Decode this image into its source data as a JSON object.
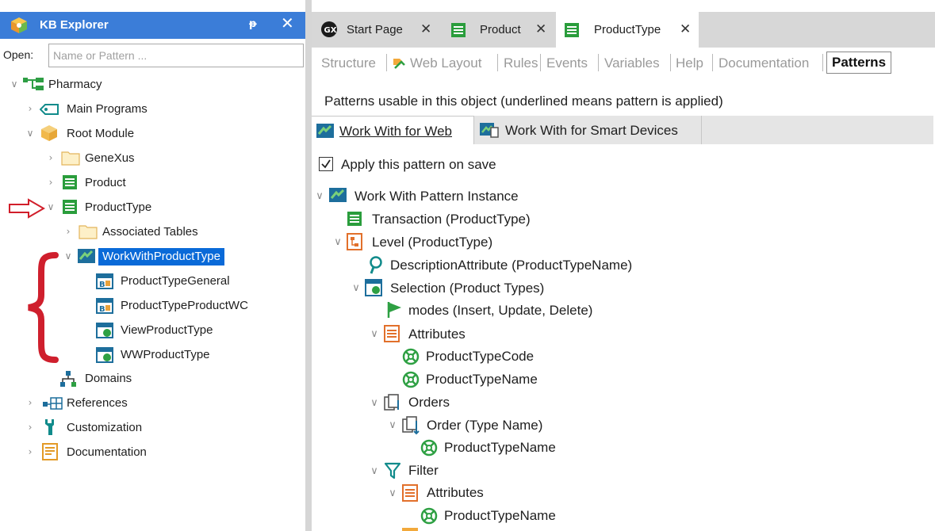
{
  "kb_explorer": {
    "title": "KB Explorer",
    "pin_glyph": "ᵽ",
    "close_glyph": "✕",
    "open_label": "Open:",
    "open_placeholder": "Name or Pattern ...",
    "tree": {
      "root": "Pharmacy",
      "main_programs": "Main Programs",
      "root_module": "Root Module",
      "genexus": "GeneXus",
      "product": "Product",
      "product_type": "ProductType",
      "associated_tables": "Associated Tables",
      "work_with_product_type": "WorkWithProductType",
      "product_type_general": "ProductTypeGeneral",
      "product_type_product_wc": "ProductTypeProductWC",
      "view_product_type": "ViewProductType",
      "ww_product_type": "WWProductType",
      "domains": "Domains",
      "references": "References",
      "customization": "Customization",
      "documentation": "Documentation"
    }
  },
  "editor": {
    "tabs": [
      {
        "label": "Start Page",
        "icon": "genexus-logo-icon",
        "active": false
      },
      {
        "label": "Product",
        "icon": "transaction-icon",
        "active": false
      },
      {
        "label": "ProductType",
        "icon": "transaction-icon",
        "active": true
      }
    ],
    "tab_close_glyph": "✕",
    "subtabs": [
      "Structure",
      "Web Layout",
      "Rules",
      "Events",
      "Variables",
      "Help",
      "Documentation",
      "Patterns"
    ],
    "active_subtab": "Patterns",
    "patterns_description": "Patterns usable in this object (underlined means pattern is applied)",
    "pattern_tabs": [
      "Work With for Web",
      "Work With for Smart Devices"
    ],
    "apply_on_save_label": "Apply this pattern on save",
    "apply_on_save_checked": true,
    "instance_tree": {
      "instance": "Work With Pattern Instance",
      "transaction": "Transaction (ProductType)",
      "level": "Level (ProductType)",
      "description_attribute": "DescriptionAttribute (ProductTypeName)",
      "selection": "Selection (Product Types)",
      "modes": "modes (Insert, Update, Delete)",
      "attributes": "Attributes",
      "attr_code": "ProductTypeCode",
      "attr_name": "ProductTypeName",
      "orders": "Orders",
      "order": "Order (Type Name)",
      "order_attr": "ProductTypeName",
      "filter": "Filter",
      "filter_attributes": "Attributes",
      "filter_attr": "ProductTypeName"
    }
  },
  "annotations": {
    "arrow_color": "#d11e2a",
    "brace_color": "#cf1f2d"
  },
  "colors": {
    "kb_header": "#3b7dd8",
    "selection": "#0a6ad8",
    "tab_bar": "#d7d7d7"
  }
}
